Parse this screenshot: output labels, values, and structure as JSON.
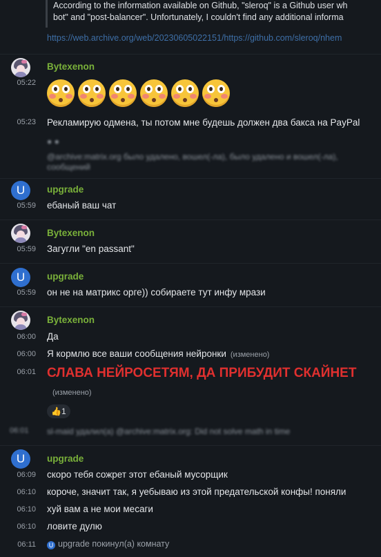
{
  "quote": {
    "line1": "According to the information available on Github, \"sleroq\" is a Github user wh",
    "line2": "bot\" and \"post-balancer\". Unfortunately, I couldn't find any additional informa"
  },
  "link_text": "https://web.archive.org/web/20230605022151/https://github.com/sleroq/nhem",
  "messages": [
    {
      "time": "05:22",
      "sender": "Bytexenon",
      "emoji_count": 6
    },
    {
      "time": "05:23",
      "text": "Рекламирую одмена, ты потом мне будешь должен два бакса на PayPal"
    },
    {
      "blurred1": "@archive:matrix.org было удалено, вошел(-ла), было удалено и вошел(-ла),",
      "blurred2": "сообщений"
    },
    {
      "time": "05:59",
      "sender": "upgrade",
      "text": "ебаный ваш чат"
    },
    {
      "time": "05:59",
      "sender": "Bytexenon",
      "text": "Загугли \"en passant\""
    },
    {
      "time": "05:59",
      "sender": "upgrade",
      "text": "он не на матрикс орге)) собираете тут инфу мрази"
    },
    {
      "time": "06:00",
      "sender": "Bytexenon",
      "text": "Да"
    },
    {
      "time": "06:00",
      "text": "Я кормлю все ваши сообщения нейронки",
      "edited": "(изменено)"
    },
    {
      "time": "06:01",
      "text": "СЛАВА НЕЙРОСЕТЯМ, ДА ПРИБУДИТ СКАЙНЕТ",
      "edited": "(изменено)",
      "reaction": "👍1"
    },
    {
      "time": "06:01",
      "blurred": "sl-maid удалил(а) @archive:matrix.org: Did not solve math in time"
    },
    {
      "time": "06:09",
      "sender": "upgrade",
      "text": "скоро тебя сожрет этот ебаный мусорщик"
    },
    {
      "time": "06:10",
      "text": "короче, значит так, я уебываю из этой предательской конфы! поняли"
    },
    {
      "time": "06:10",
      "text": "хуй вам а не мои месаги"
    },
    {
      "time": "06:10",
      "text": "ловите дулю"
    },
    {
      "time": "06:11",
      "event": "upgrade покинул(а) комнату"
    }
  ],
  "avatar_letter": "U",
  "colors": {
    "background": "#15191e",
    "sender_name": "#7ab13a",
    "big_text": "#e0302f",
    "avatar_u": "#2f6fcf",
    "link": "#3e6fa7"
  }
}
